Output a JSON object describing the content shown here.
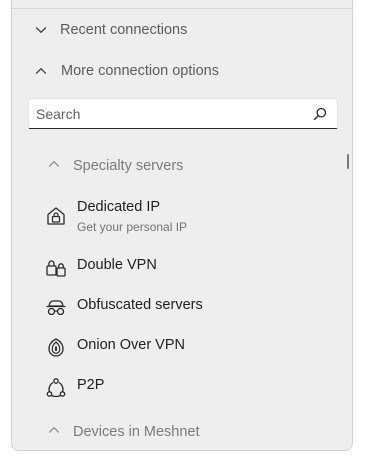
{
  "sections": {
    "recent": {
      "label": "Recent connections"
    },
    "more": {
      "label": "More connection options"
    }
  },
  "search": {
    "placeholder": "Search",
    "value": ""
  },
  "specialty": {
    "label": "Specialty servers",
    "items": [
      {
        "label": "Dedicated IP",
        "sublabel": "Get your personal IP",
        "icon": "house-lock-icon"
      },
      {
        "label": "Double VPN",
        "icon": "double-lock-icon"
      },
      {
        "label": "Obfuscated servers",
        "icon": "incognito-glasses-icon"
      },
      {
        "label": "Onion Over VPN",
        "icon": "onion-icon"
      },
      {
        "label": "P2P",
        "icon": "p2p-network-icon"
      }
    ]
  },
  "meshnet": {
    "label": "Devices in Meshnet"
  }
}
